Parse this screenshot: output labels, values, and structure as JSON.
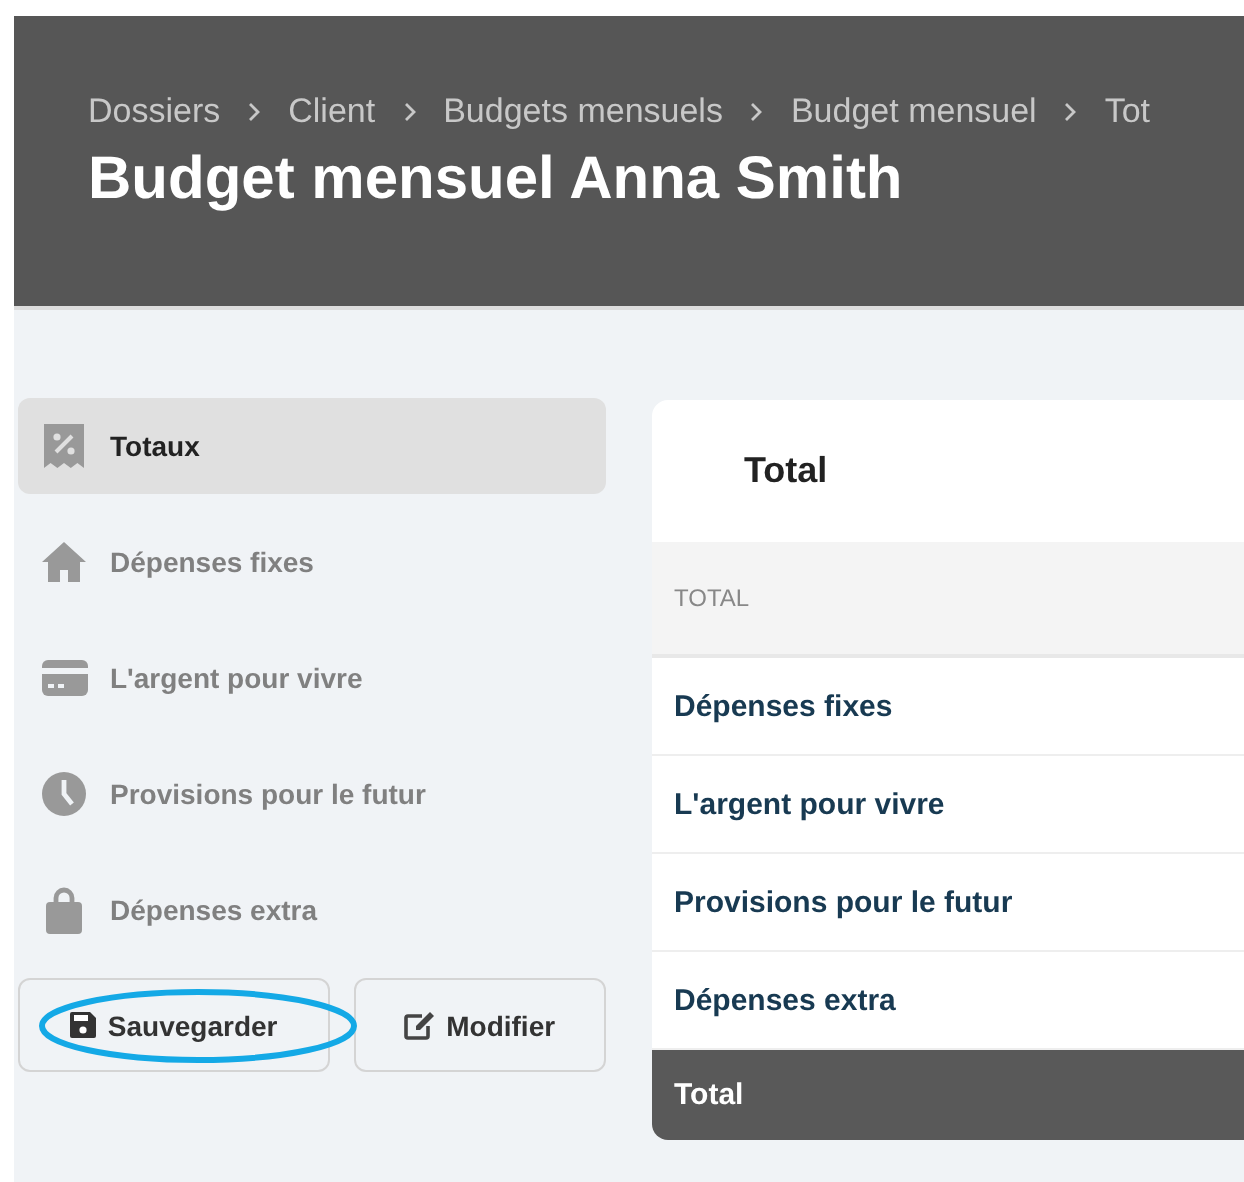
{
  "header": {
    "breadcrumbs": [
      "Dossiers",
      "Client",
      "Budgets mensuels",
      "Budget mensuel",
      "Tot"
    ],
    "title": "Budget mensuel Anna Smith"
  },
  "sidebar": {
    "items": [
      {
        "label": "Totaux",
        "selected": true
      },
      {
        "label": "Dépenses fixes",
        "selected": false
      },
      {
        "label": "L'argent pour vivre",
        "selected": false
      },
      {
        "label": "Provisions pour le futur",
        "selected": false
      },
      {
        "label": "Dépenses extra",
        "selected": false
      }
    ]
  },
  "buttons": [
    {
      "label": "Sauvegarder",
      "highlighted": true
    },
    {
      "label": "Modifier",
      "highlighted": false
    }
  ],
  "table": {
    "title": "Total",
    "columns": [
      "TOTAL"
    ],
    "rows": [
      {
        "label": "Dépenses fixes"
      },
      {
        "label": "L'argent pour vivre"
      },
      {
        "label": "Provisions pour le futur"
      },
      {
        "label": "Dépenses extra"
      }
    ],
    "footer": "Total"
  }
}
